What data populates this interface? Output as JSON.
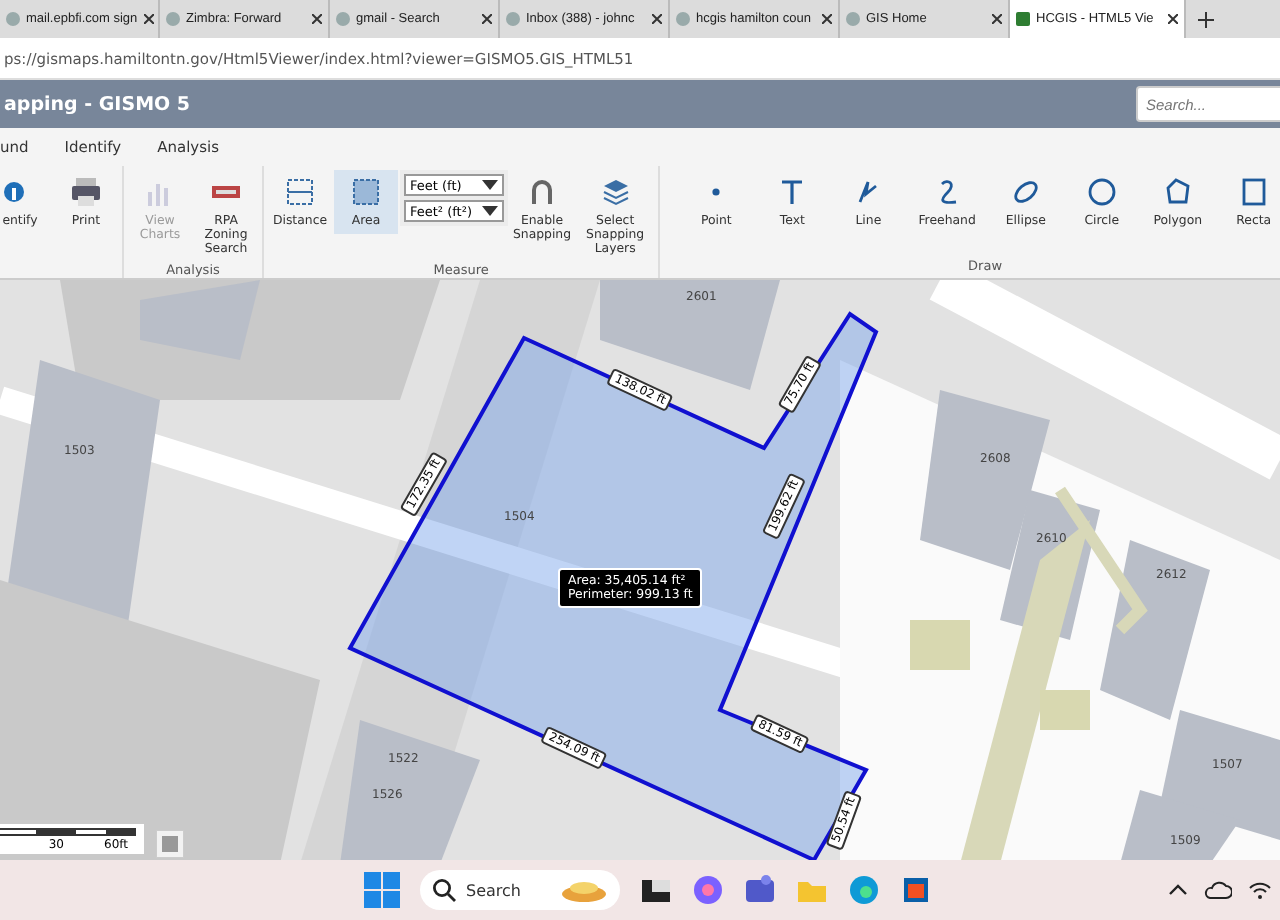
{
  "browser": {
    "tabs": [
      {
        "title": "mail.epbfi.com sign",
        "selected": false
      },
      {
        "title": "Zimbra: Forward",
        "selected": false
      },
      {
        "title": "gmail - Search",
        "selected": false
      },
      {
        "title": "Inbox (388) - johnc",
        "selected": false
      },
      {
        "title": "hcgis hamilton coun",
        "selected": false
      },
      {
        "title": "GIS Home",
        "selected": false
      },
      {
        "title": "HCGIS - HTML5 Vie",
        "selected": true
      }
    ],
    "address": "ps://gismaps.hamiltontn.gov/Html5Viewer/index.html?viewer=GISMO5.GIS_HTML51"
  },
  "app": {
    "title": "apping - GISMO 5",
    "search": {
      "placeholder": "Search..."
    }
  },
  "menu": [
    "und",
    "Identify",
    "Analysis"
  ],
  "ribbon": [
    {
      "tools": [
        {
          "kind": "button",
          "label": "entify",
          "disabled": false,
          "selected": false
        },
        {
          "kind": "button",
          "label": "Print",
          "disabled": false,
          "selected": false
        }
      ]
    },
    {
      "label": "Analysis",
      "tools": [
        {
          "kind": "button",
          "label": "View Charts",
          "disabled": true,
          "selected": false
        },
        {
          "kind": "button",
          "label": "RPA Zoning Search",
          "disabled": false,
          "selected": false
        }
      ]
    },
    {
      "label": "Measure",
      "tools": [
        {
          "kind": "button",
          "label": "Distance",
          "disabled": false,
          "selected": false
        },
        {
          "kind": "button",
          "label": "Area",
          "disabled": false,
          "selected": true
        },
        {
          "kind": "selects",
          "options": [
            "Feet (ft)",
            "Feet² (ft²)"
          ]
        },
        {
          "kind": "button",
          "label": "Enable Snapping",
          "disabled": false,
          "selected": false
        },
        {
          "kind": "button",
          "label": "Select Snapping Layers",
          "disabled": false,
          "selected": false
        }
      ]
    },
    {
      "label": "Draw",
      "tools": [
        {
          "kind": "button",
          "label": "Point",
          "disabled": false,
          "selected": false
        },
        {
          "kind": "button",
          "label": "Text",
          "disabled": false,
          "selected": false
        },
        {
          "kind": "button",
          "label": "Line",
          "disabled": false,
          "selected": false
        },
        {
          "kind": "button",
          "label": "Freehand",
          "disabled": false,
          "selected": false
        },
        {
          "kind": "button",
          "label": "Ellipse",
          "disabled": false,
          "selected": false
        },
        {
          "kind": "button",
          "label": "Circle",
          "disabled": false,
          "selected": false
        },
        {
          "kind": "button",
          "label": "Polygon",
          "disabled": false,
          "selected": false
        },
        {
          "kind": "button",
          "label": "Recta",
          "disabled": false,
          "selected": false
        }
      ]
    }
  ],
  "map": {
    "parcels": [
      "2601",
      "1503",
      "1504",
      "2608",
      "2610",
      "2612",
      "1522",
      "1526",
      "1507",
      "1509"
    ],
    "edges": [
      "138.02 ft",
      "75.70 ft",
      "172.35 ft",
      "199.62 ft",
      "254.09 ft",
      "81.59 ft",
      "50.54 ft"
    ],
    "measurement": {
      "area": "Area: 35,405.14 ft²",
      "perimeter": "Perimeter: 999.13 ft"
    },
    "scale": [
      "30",
      "60ft"
    ]
  },
  "taskbar": {
    "search": {
      "placeholder": "Search"
    }
  }
}
